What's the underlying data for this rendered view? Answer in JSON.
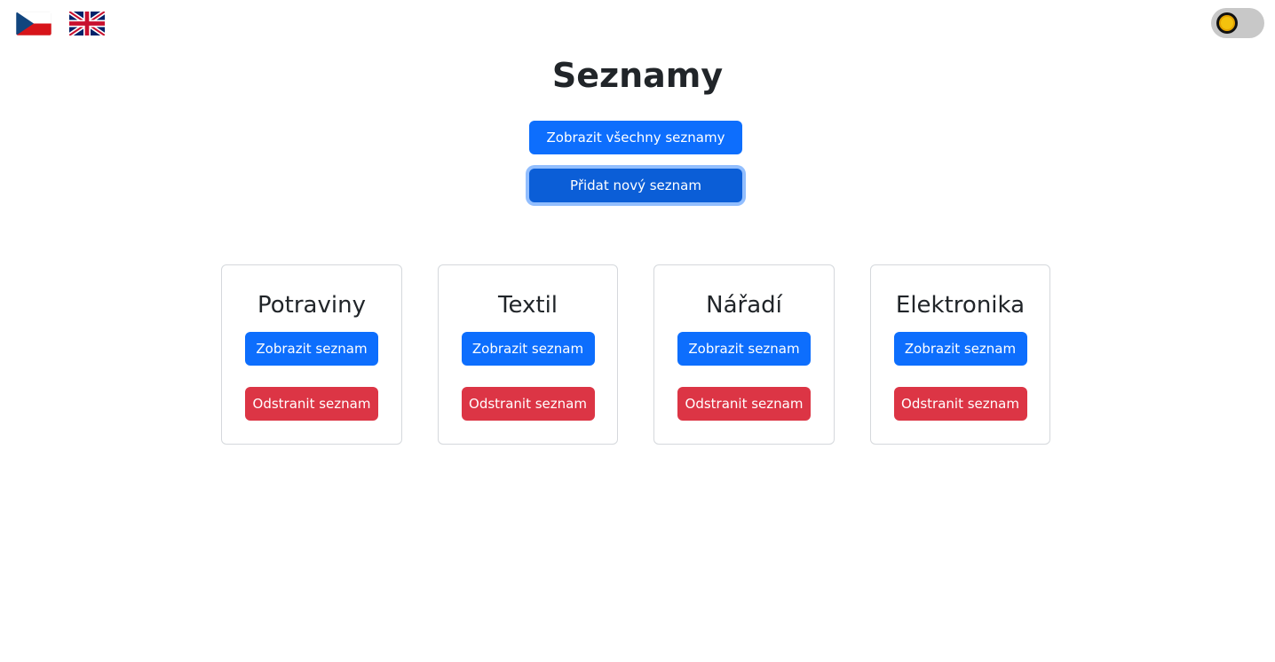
{
  "header": {
    "languages": [
      {
        "code": "cs",
        "icon": "czech-flag-icon"
      },
      {
        "code": "en",
        "icon": "uk-flag-icon"
      }
    ],
    "theme_toggle": {
      "icon": "sun-icon",
      "state": "light"
    }
  },
  "main": {
    "title": "Seznamy",
    "show_all_label": "Zobrazit všechny seznamy",
    "add_new_label": "Přidat nový seznam"
  },
  "lists": [
    {
      "name": "Potraviny",
      "show_label": "Zobrazit seznam",
      "delete_label": "Odstranit seznam"
    },
    {
      "name": "Textil",
      "show_label": "Zobrazit seznam",
      "delete_label": "Odstranit seznam"
    },
    {
      "name": "Nářadí",
      "show_label": "Zobrazit seznam",
      "delete_label": "Odstranit seznam"
    },
    {
      "name": "Elektronika",
      "show_label": "Zobrazit seznam",
      "delete_label": "Odstranit seznam"
    }
  ],
  "colors": {
    "primary": "#0d6efd",
    "primary_active": "#0b5ed7",
    "danger": "#dc3545",
    "text": "#212529",
    "card_border": "#d5d8dc"
  }
}
